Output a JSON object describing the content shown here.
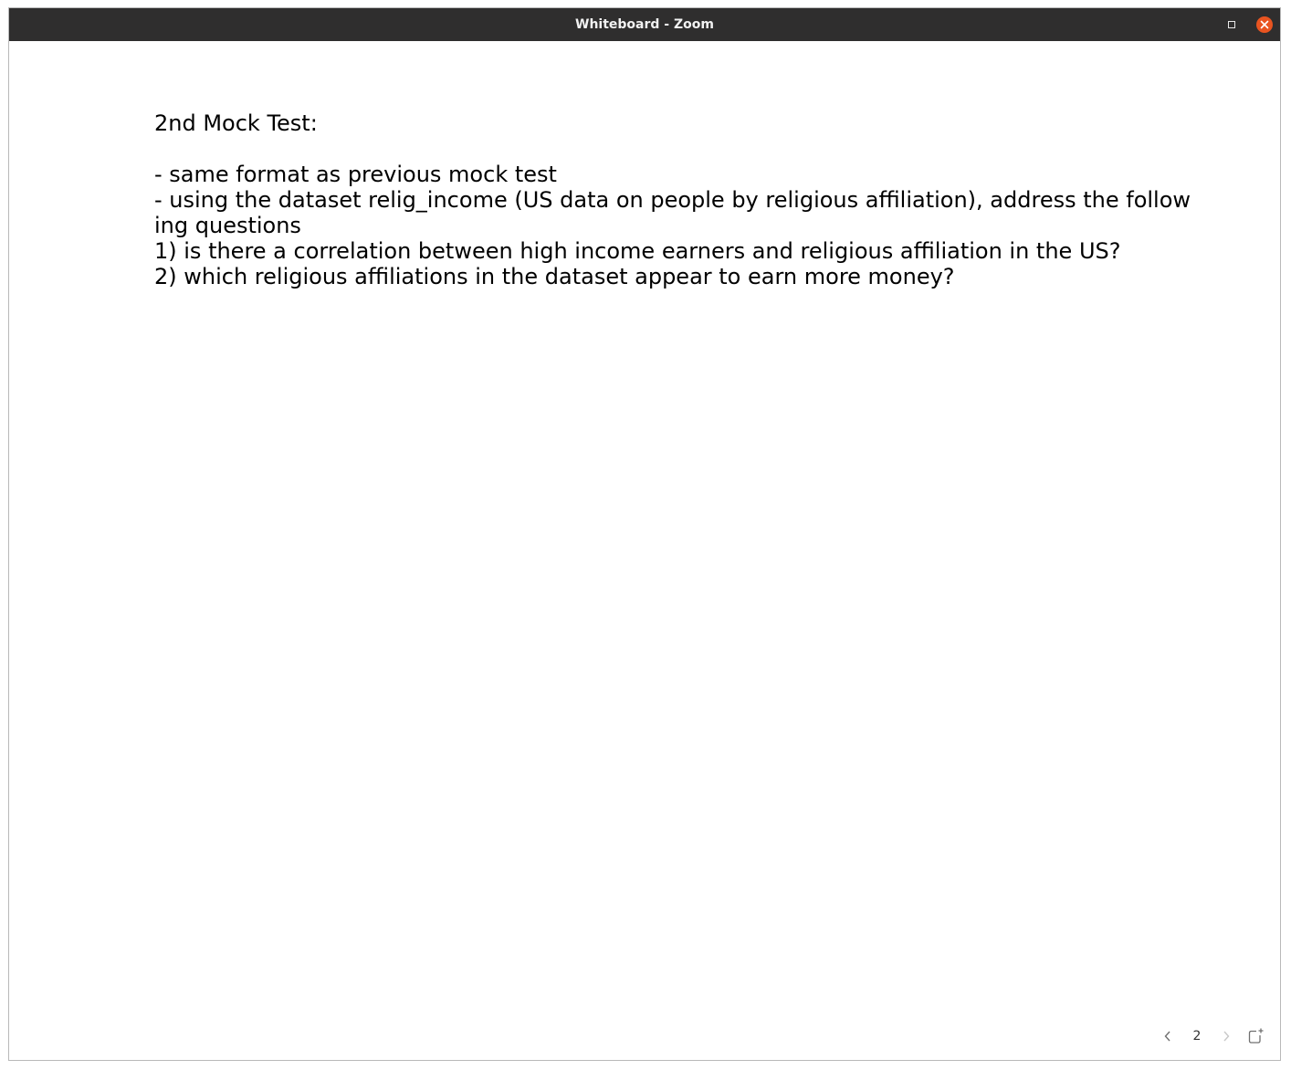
{
  "window": {
    "title": "Whiteboard - Zoom"
  },
  "whiteboard": {
    "lines": [
      "2nd Mock Test:",
      "",
      "- same format as previous mock test",
      "- using the dataset relig_income (US data on people by religious affiliation), address the follow",
      "ing questions",
      "1) is there a correlation between high income earners and religious affiliation in the US?",
      "2) which religious affiliations in the dataset appear to earn more money?"
    ]
  },
  "pager": {
    "current_page": "2"
  },
  "icons": {
    "maximize": "maximize-icon",
    "close": "close-icon",
    "previous": "chevron-left-icon",
    "next": "chevron-right-icon",
    "add_page": "add-page-icon"
  },
  "colors": {
    "titlebar": "#2f2e2e",
    "close_button": "#e95420",
    "canvas": "#ffffff",
    "text": "#000000"
  }
}
